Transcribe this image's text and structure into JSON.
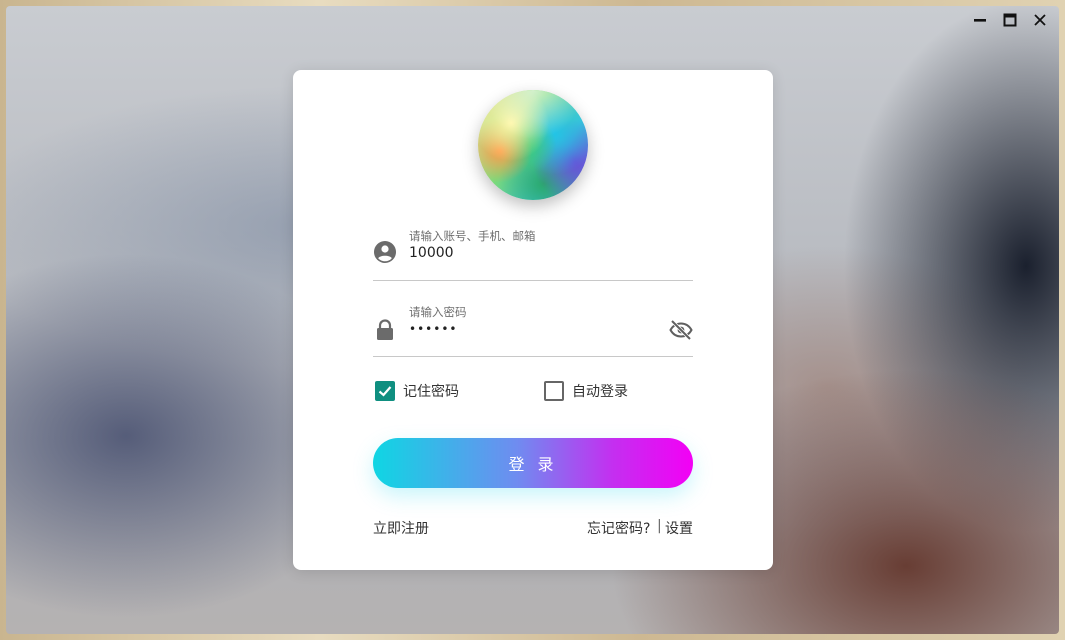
{
  "window": {
    "controls": {
      "minimize": "minimize-icon",
      "maximize": "maximize-icon",
      "close": "close-icon"
    }
  },
  "login": {
    "avatar_icon": "avatar-image",
    "account": {
      "label": "请输入账号、手机、邮箱",
      "value": "10000",
      "icon": "account-circle-icon"
    },
    "password": {
      "label": "请输入密码",
      "value": "••••••",
      "icon": "lock-icon",
      "toggle_icon": "eye-off-icon"
    },
    "remember": {
      "label": "记住密码",
      "checked": true
    },
    "auto_login": {
      "label": "自动登录",
      "checked": false
    },
    "submit_label": "登 录",
    "register_label": "立即注册",
    "forgot_label": "忘记密码?",
    "separator": "|",
    "settings_label": "设置"
  },
  "colors": {
    "accent": "#0f8f80",
    "button_gradient_start": "#0fd6e3",
    "button_gradient_end": "#f300f5"
  }
}
